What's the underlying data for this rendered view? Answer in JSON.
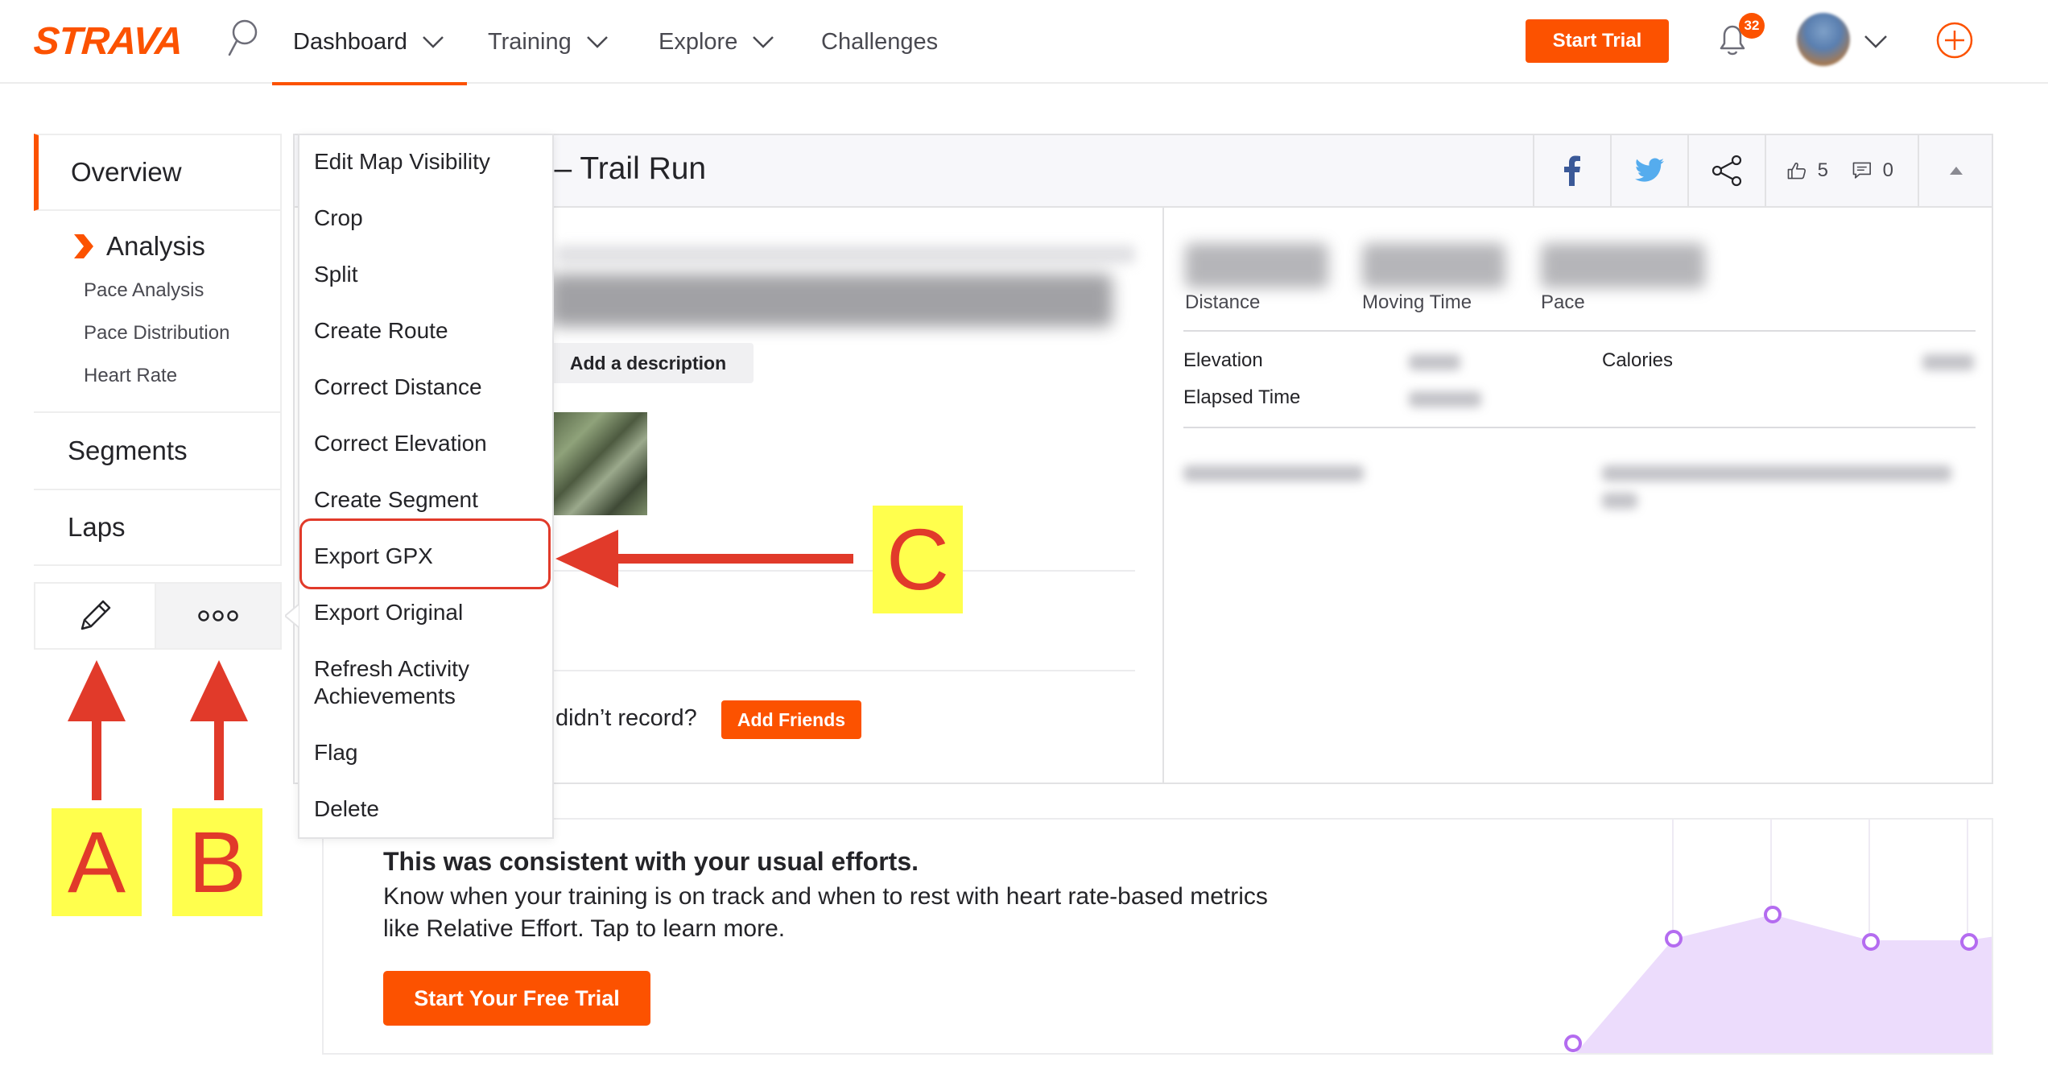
{
  "nav": {
    "logo": "STRAVA",
    "items": [
      {
        "label": "Dashboard"
      },
      {
        "label": "Training"
      },
      {
        "label": "Explore"
      },
      {
        "label": "Challenges"
      }
    ],
    "start_trial": "Start Trial",
    "notification_count": "32",
    "accent_color": "#fc5200"
  },
  "sidebar": {
    "overview": "Overview",
    "analysis": "Analysis",
    "analysis_links": [
      "Pace Analysis",
      "Pace Distribution",
      "Heart Rate"
    ],
    "segments": "Segments",
    "laps": "Laps",
    "edit_icon": "pencil-icon",
    "more_icon": "more-dots-icon"
  },
  "activity": {
    "title": "n – Trail Run",
    "add_description": "Add a description",
    "didnt_record": "didn’t record?",
    "add_friends": "Add Friends",
    "kudos_count": "5",
    "comment_count": "0",
    "stats": {
      "distance_label": "Distance",
      "moving_time_label": "Moving Time",
      "pace_label": "Pace",
      "elevation_label": "Elevation",
      "elapsed_time_label": "Elapsed Time",
      "calories_label": "Calories"
    }
  },
  "menu": {
    "items": [
      "Edit Map Visibility",
      "Crop",
      "Split",
      "Create Route",
      "Correct Distance",
      "Correct Elevation",
      "Create Segment",
      "Export GPX",
      "Export Original",
      "Refresh Activity Achievements",
      "Flag",
      "Delete"
    ],
    "refresh_line1": "Refresh Activity",
    "refresh_line2": "Achievements",
    "highlighted": "Export GPX"
  },
  "promo": {
    "title": "This was consistent with your usual efforts.",
    "body": "Know when your training is on track and when to rest with heart rate-based metrics like Relative Effort. Tap to learn more.",
    "button": "Start Your Free Trial",
    "chart_color": "#b46cf0"
  },
  "annotations": {
    "a": "A",
    "b": "B",
    "c": "C",
    "color": "#e13a2a",
    "label_bg": "#ffff4d"
  }
}
